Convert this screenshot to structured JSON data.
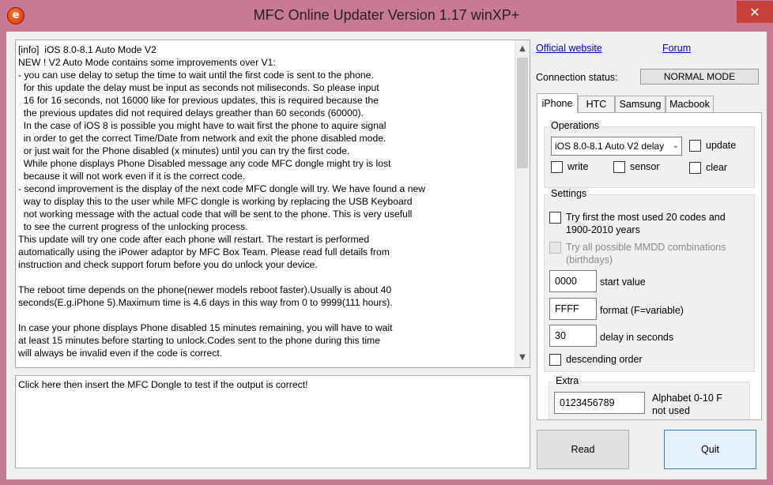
{
  "window": {
    "title": "MFC Online Updater Version 1.17 winXP+",
    "close_glyph": "✕",
    "icon_name": "mfc-app-icon"
  },
  "log": {
    "lines": [
      "[info]  iOS 8.0-8.1 Auto Mode V2",
      "NEW ! V2 Auto Mode contains some improvements over V1:",
      "- you can use delay to setup the time to wait until the first code is sent to the phone.",
      "  for this update the delay must be input as seconds not miliseconds. So please input",
      "  16 for 16 seconds, not 16000 like for previous updates, this is required because the",
      "  the previous updates did not required delays greather than 60 seconds (60000).",
      "  In the case of iOS 8 is possible you might have to wait first the phone to aquire signal",
      "  in order to get the correct Time/Date from network and exit the phone disabled mode.",
      "  or just wait for the Phone disabled (x minutes) until you can try the first code.",
      "  While phone displays Phone Disabled message any code MFC dongle might try is lost",
      "  because it will not work even if it is the correct code.",
      "- second improvement is the display of the next code MFC dongle will try. We have found a new",
      "  way to display this to the user while MFC dongle is working by replacing the USB Keyboard",
      "  not working message with the actual code that will be sent to the phone. This is very usefull",
      "  to see the current progress of the unlocking process.",
      "This update will try one code after each phone will restart. The restart is performed",
      "automatically using the iPower adaptor by MFC Box Team. Please read full details from",
      "instruction and check support forum before you do unlock your device.",
      "",
      "The reboot time depends on the phone(newer models reboot faster).Usually is about 40",
      "seconds(E.g.iPhone 5).Maximum time is 4.6 days in this way from 0 to 9999(111 hours).",
      "",
      "In case your phone displays Phone disabled 15 minutes remaining, you will have to wait",
      "at least 15 minutes before starting to unlock.Codes sent to the phone during this time",
      "will always be invalid even if the code is correct."
    ],
    "scroll_up_glyph": "▲",
    "scroll_down_glyph": "▼"
  },
  "output": {
    "text": "Click here then insert the MFC Dongle to test if the output is correct!"
  },
  "links": {
    "official_website": "Official website",
    "forum": "Forum"
  },
  "connection": {
    "label": "Connection status:",
    "value": "NORMAL MODE"
  },
  "tabs": [
    {
      "label": "iPhone",
      "active": true
    },
    {
      "label": "HTC",
      "active": false
    },
    {
      "label": "Samsung",
      "active": false
    },
    {
      "label": "Macbook",
      "active": false
    }
  ],
  "operations": {
    "title": "Operations",
    "selected": "iOS 8.0-8.1 Auto V2 delay",
    "dropdown_glyph": "⌄",
    "update_label": "update",
    "write_label": "write",
    "sensor_label": "sensor",
    "clear_label": "clear"
  },
  "settings": {
    "title": "Settings",
    "try_first_label": "Try first the most used 20 codes and 1900-2010 years",
    "try_all_label": "Try all possible MMDD combinations (birthdays)",
    "start_value": "0000",
    "start_value_label": "start value",
    "format_value": "FFFF",
    "format_label": "format (F=variable)",
    "delay_value": "30",
    "delay_label": "delay in seconds",
    "descending_label": "descending order"
  },
  "extra": {
    "title": "Extra",
    "alphabet_value": "0123456789",
    "alphabet_label": "Alphabet 0-10 F not used"
  },
  "buttons": {
    "read": "Read",
    "quit": "Quit"
  }
}
